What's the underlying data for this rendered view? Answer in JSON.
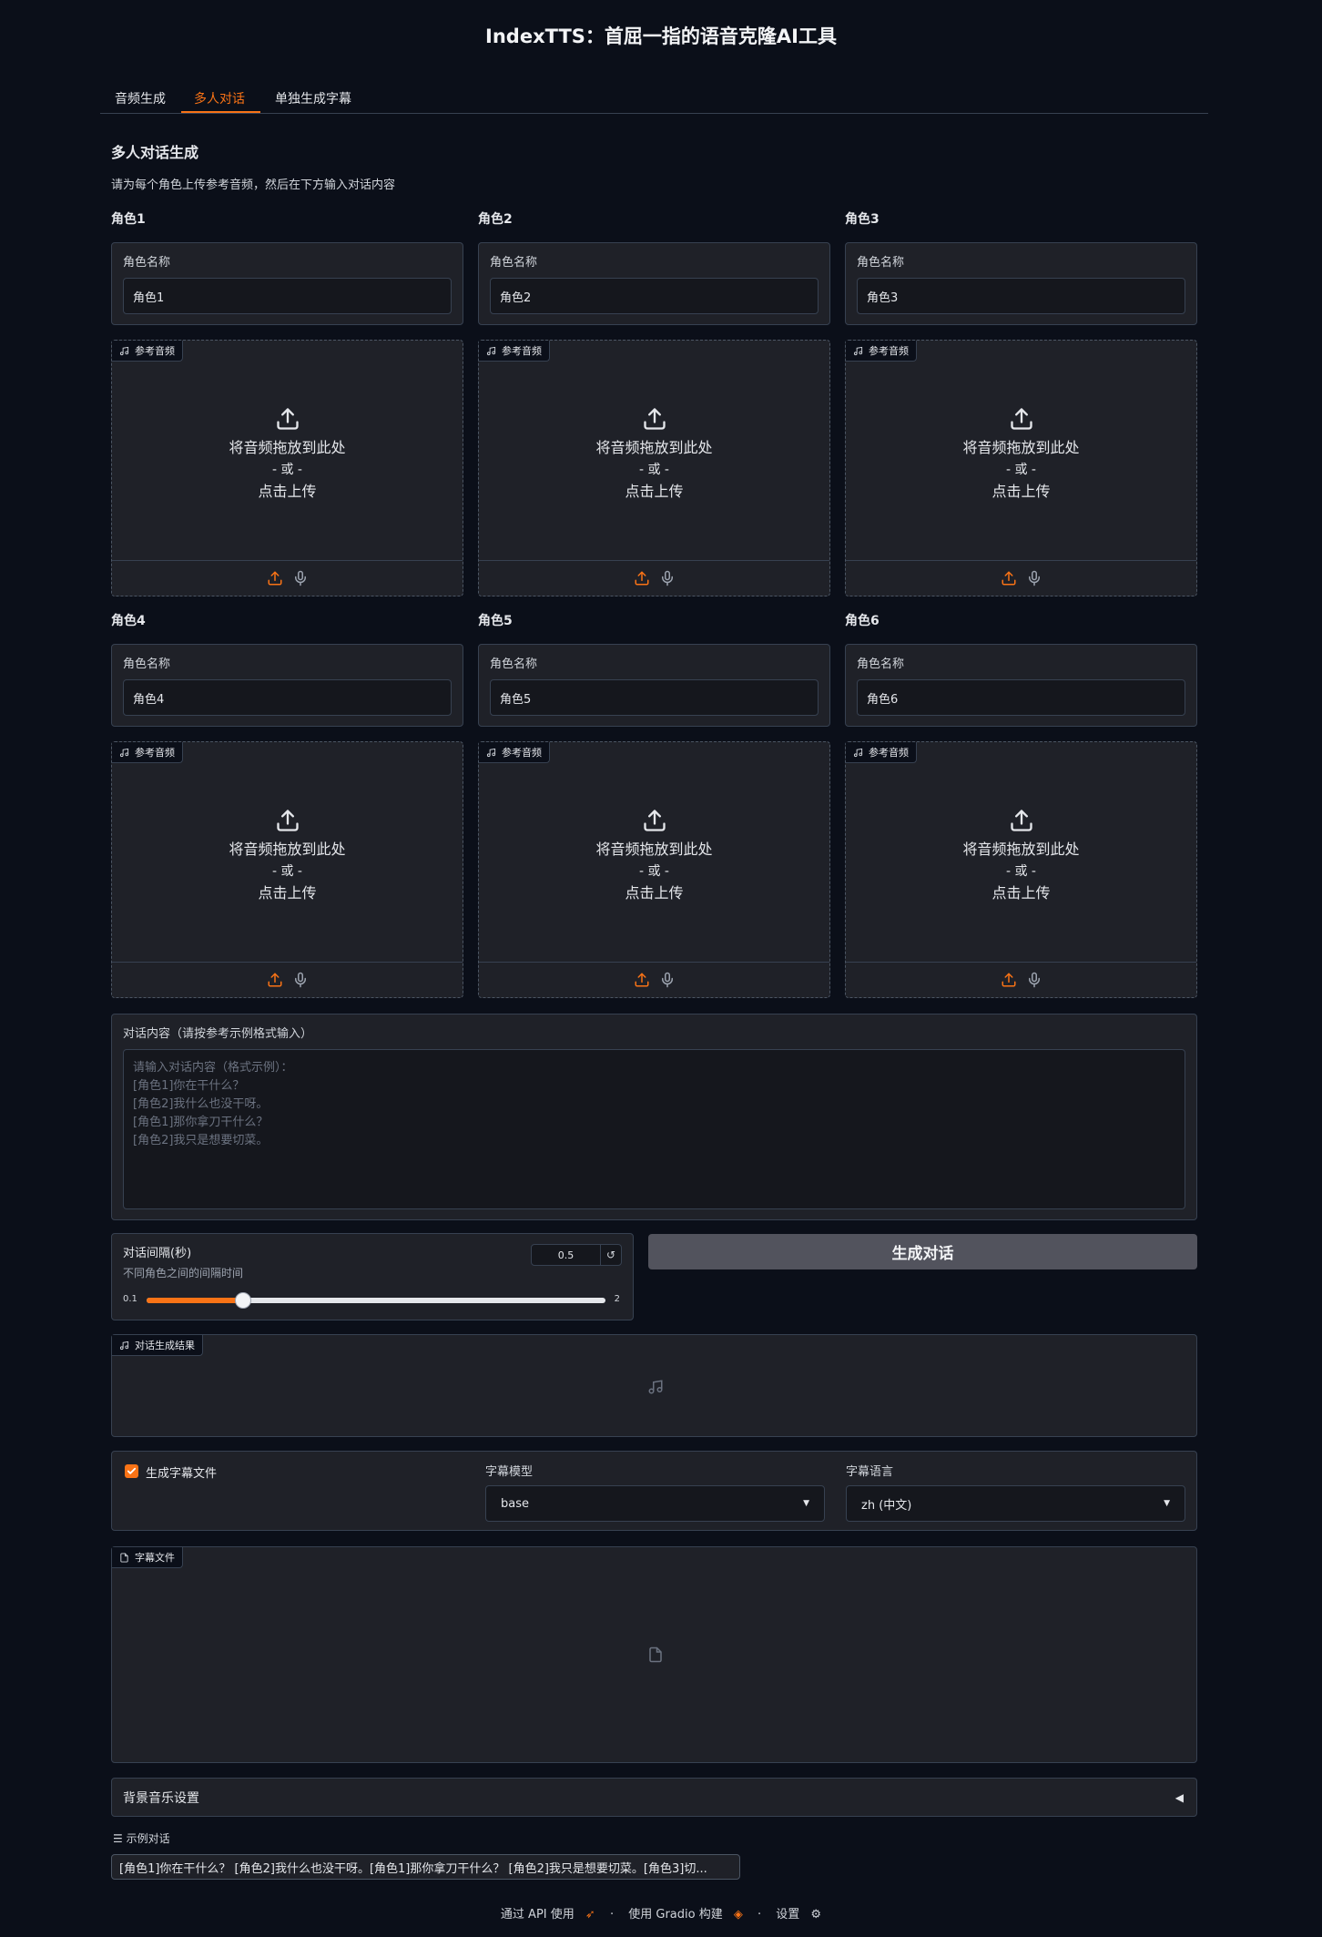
{
  "app": {
    "title": "IndexTTS：首屈一指的语音克隆AI工具"
  },
  "tabs": [
    {
      "label": "音频生成"
    },
    {
      "label": "多人对话"
    },
    {
      "label": "单独生成字幕"
    }
  ],
  "section": {
    "title": "多人对话生成",
    "desc": "请为每个角色上传参考音频，然后在下方输入对话内容"
  },
  "roles": [
    {
      "header": "角色1",
      "name_label": "角色名称",
      "name_value": "角色1"
    },
    {
      "header": "角色2",
      "name_label": "角色名称",
      "name_value": "角色2"
    },
    {
      "header": "角色3",
      "name_label": "角色名称",
      "name_value": "角色3"
    },
    {
      "header": "角色4",
      "name_label": "角色名称",
      "name_value": "角色4"
    },
    {
      "header": "角色5",
      "name_label": "角色名称",
      "name_value": "角色5"
    },
    {
      "header": "角色6",
      "name_label": "角色名称",
      "name_value": "角色6"
    }
  ],
  "upload": {
    "tag": "参考音频",
    "drop_text": "将音频拖放到此处",
    "or_text": "- 或 -",
    "click_text": "点击上传"
  },
  "dialog": {
    "label": "对话内容（请按参考示例格式输入）",
    "placeholder": "请输入对话内容（格式示例）：\n[角色1]你在干什么？\n[角色2]我什么也没干呀。\n[角色1]那你拿刀干什么？\n[角色2]我只是想要切菜。"
  },
  "interval": {
    "label": "对话间隔(秒)",
    "info": "不同角色之间的间隔时间",
    "value": "0.5",
    "min": "0.1",
    "max": "2",
    "fraction": 0.21
  },
  "generate_button": "生成对话",
  "result": {
    "tag": "对话生成结果"
  },
  "subtitle": {
    "checkbox_label": "生成字幕文件",
    "checked": true,
    "model_label": "字幕模型",
    "model_value": "base",
    "lang_label": "字幕语言",
    "lang_value": "zh (中文)"
  },
  "subtitle_file": {
    "tag": "字幕文件"
  },
  "bgm": {
    "label": "背景音乐设置",
    "arrow": "◀"
  },
  "examples": {
    "label": "示例对话",
    "items": [
      "[角色1]你在干什么？ [角色2]我什么也没干呀。[角色1]那你拿刀干什么？ [角色2]我只是想要切菜。[角色3]切..."
    ]
  },
  "footer": {
    "api": "通过 API 使用",
    "built": "使用 Gradio 构建",
    "settings": "设置",
    "sep": "·"
  },
  "colors": {
    "accent": "#f97316",
    "background": "#0b0f19",
    "panel": "#1f2128"
  }
}
